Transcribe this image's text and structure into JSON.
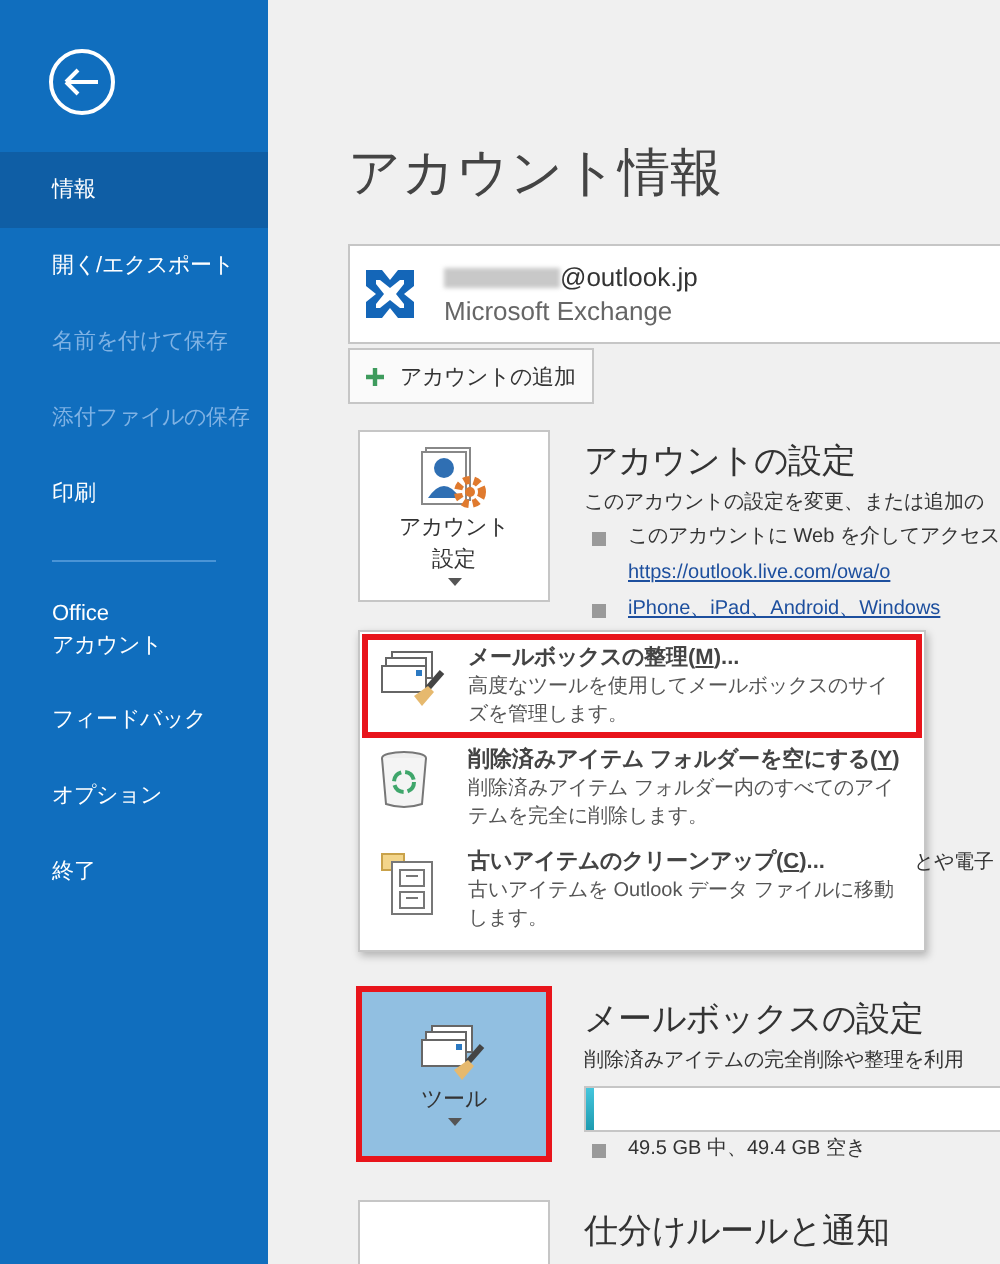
{
  "sidebar": {
    "items": [
      {
        "label": "情報",
        "selected": true,
        "disabled": false,
        "divider_before": false
      },
      {
        "label": "開く/エクスポート",
        "selected": false,
        "disabled": false,
        "divider_before": false
      },
      {
        "label": "名前を付けて保存",
        "selected": false,
        "disabled": true,
        "divider_before": false
      },
      {
        "label": "添付ファイルの保存",
        "selected": false,
        "disabled": true,
        "divider_before": false
      },
      {
        "label": "印刷",
        "selected": false,
        "disabled": false,
        "divider_before": false
      },
      {
        "label": "Office\nアカウント",
        "selected": false,
        "disabled": false,
        "divider_before": true
      },
      {
        "label": "フィードバック",
        "selected": false,
        "disabled": false,
        "divider_before": false
      },
      {
        "label": "オプション",
        "selected": false,
        "disabled": false,
        "divider_before": false
      },
      {
        "label": "終了",
        "selected": false,
        "disabled": false,
        "divider_before": false
      }
    ]
  },
  "page_title": "アカウント情報",
  "account": {
    "email_domain": "@outlook.jp",
    "type": "Microsoft Exchange"
  },
  "add_account_button": "アカウントの追加",
  "sections": [
    {
      "kind": "account",
      "button": [
        "アカウント",
        "設定"
      ],
      "has_caret": true,
      "pressed": false,
      "highlighted": false,
      "heading": "アカウントの設定",
      "description": "このアカウントの設定を変更、または追加の",
      "bullets": [
        {
          "text": "このアカウントに Web を介してアクセス",
          "link": "https://outlook.live.com/owa/o"
        },
        {
          "link": "iPhone、iPad、Android、Windows"
        }
      ],
      "fragment": "とや電子"
    },
    {
      "kind": "tools",
      "button": [
        "ツール"
      ],
      "has_caret": true,
      "pressed": true,
      "highlighted": true,
      "heading": "メールボックスの設定",
      "description": "削除済みアイテムの完全削除や整理を利用",
      "level": 0.015,
      "bullets": [
        {
          "text": "49.5 GB 中、49.4 GB 空き"
        }
      ]
    },
    {
      "kind": "rules",
      "pressed": false,
      "highlighted": false,
      "heading": "仕分けルールと通知"
    }
  ],
  "menu": {
    "items": [
      {
        "kind": "mailbox",
        "label_start": "メールボックスの整理(",
        "access_key": "M",
        "label_end": ")...",
        "description": "高度なツールを使用してメールボックスのサイズを管理します。",
        "highlighted": true
      },
      {
        "kind": "recycle",
        "label_start": "削除済みアイテム フォルダーを空にする(",
        "access_key": "Y",
        "label_end": ")",
        "description": "削除済みアイテム フォルダー内のすべてのアイテムを完全に削除します。",
        "highlighted": false
      },
      {
        "kind": "cabinet",
        "label_start": "古いアイテムのクリーンアップ(",
        "access_key": "C",
        "label_end": ")...",
        "description": "古いアイテムを Outlook データ ファイルに移動します。",
        "highlighted": false
      }
    ]
  }
}
